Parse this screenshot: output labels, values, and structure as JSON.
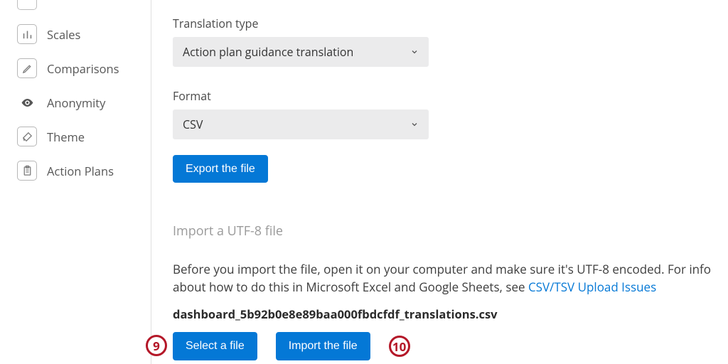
{
  "sidebar": {
    "items": [
      {
        "label": "Scales"
      },
      {
        "label": "Comparisons"
      },
      {
        "label": "Anonymity"
      },
      {
        "label": "Theme"
      },
      {
        "label": "Action Plans"
      }
    ]
  },
  "form": {
    "translation_type_label": "Translation type",
    "translation_type_value": "Action plan guidance translation",
    "format_label": "Format",
    "format_value": "CSV",
    "export_button": "Export the file"
  },
  "import": {
    "heading": "Import a UTF-8 file",
    "description_pre": "Before you import the file, open it on your computer and make sure it's UTF-8 encoded. For info about how to do this in Microsoft Excel and Google Sheets, see ",
    "link_text": "CSV/TSV Upload Issues",
    "filename": "dashboard_5b92b0e8e89baa000fbdcfdf_translations.csv",
    "select_button": "Select a file",
    "import_button": "Import the file"
  },
  "annotations": {
    "badge9": "9",
    "badge10": "10"
  }
}
